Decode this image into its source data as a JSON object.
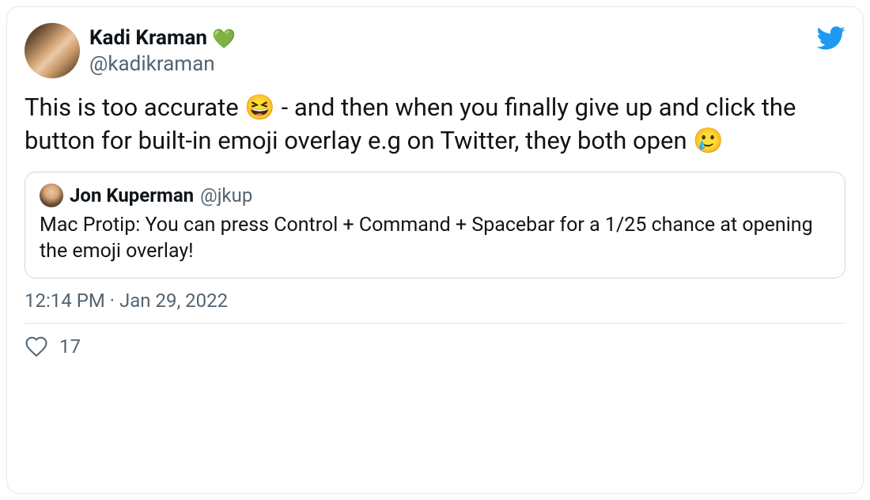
{
  "tweet": {
    "author": {
      "display_name": "Kadi Kraman",
      "heart": "💚",
      "handle": "@kadikraman"
    },
    "body": "This is too accurate 😆 - and then when you finally give up and click the button for built-in emoji overlay e.g on Twitter, they both open 🥲",
    "timestamp": "12:14 PM · Jan 29, 2022",
    "like_count": "17"
  },
  "quoted": {
    "author": {
      "display_name": "Jon Kuperman",
      "handle": "@jkup"
    },
    "body": "Mac Protip: You can press Control + Command + Spacebar for a 1/25 chance at opening the emoji overlay!"
  }
}
